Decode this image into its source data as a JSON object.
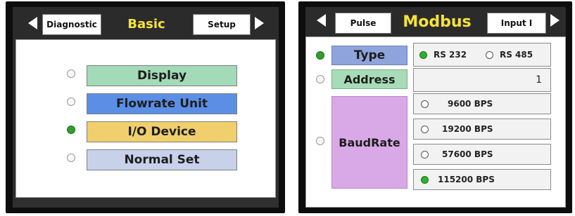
{
  "left": {
    "header": {
      "prev_label": "Diagnostic",
      "title": "Basic",
      "next_label": "Setup"
    },
    "menu": [
      {
        "label": "Display",
        "selected": false,
        "color": "#a3dab7"
      },
      {
        "label": "Flowrate Unit",
        "selected": false,
        "color": "#5b8fe6"
      },
      {
        "label": "I/O Device",
        "selected": true,
        "color": "#f0cf6c"
      },
      {
        "label": "Normal Set",
        "selected": false,
        "color": "#c7d1ea"
      }
    ]
  },
  "right": {
    "header": {
      "prev_label": "Pulse",
      "title": "Modbus",
      "next_label": "Input I"
    },
    "type": {
      "label": "Type",
      "selected": true,
      "options": [
        {
          "label": "RS 232",
          "selected": true
        },
        {
          "label": "RS 485",
          "selected": false
        }
      ]
    },
    "address": {
      "label": "Address",
      "selected": false,
      "value": "1"
    },
    "baudrate": {
      "label": "BaudRate",
      "selected": false,
      "options": [
        {
          "label": "9600 BPS",
          "selected": false
        },
        {
          "label": "19200 BPS",
          "selected": false
        },
        {
          "label": "57600 BPS",
          "selected": false
        },
        {
          "label": "115200 BPS",
          "selected": true
        }
      ]
    }
  },
  "colors": {
    "title": "#f6e33a",
    "radio_on": "#2fa02f",
    "type_label": "#8fa4dc",
    "address_label": "#a8dcb8",
    "baud_label": "#d9a8e6"
  }
}
